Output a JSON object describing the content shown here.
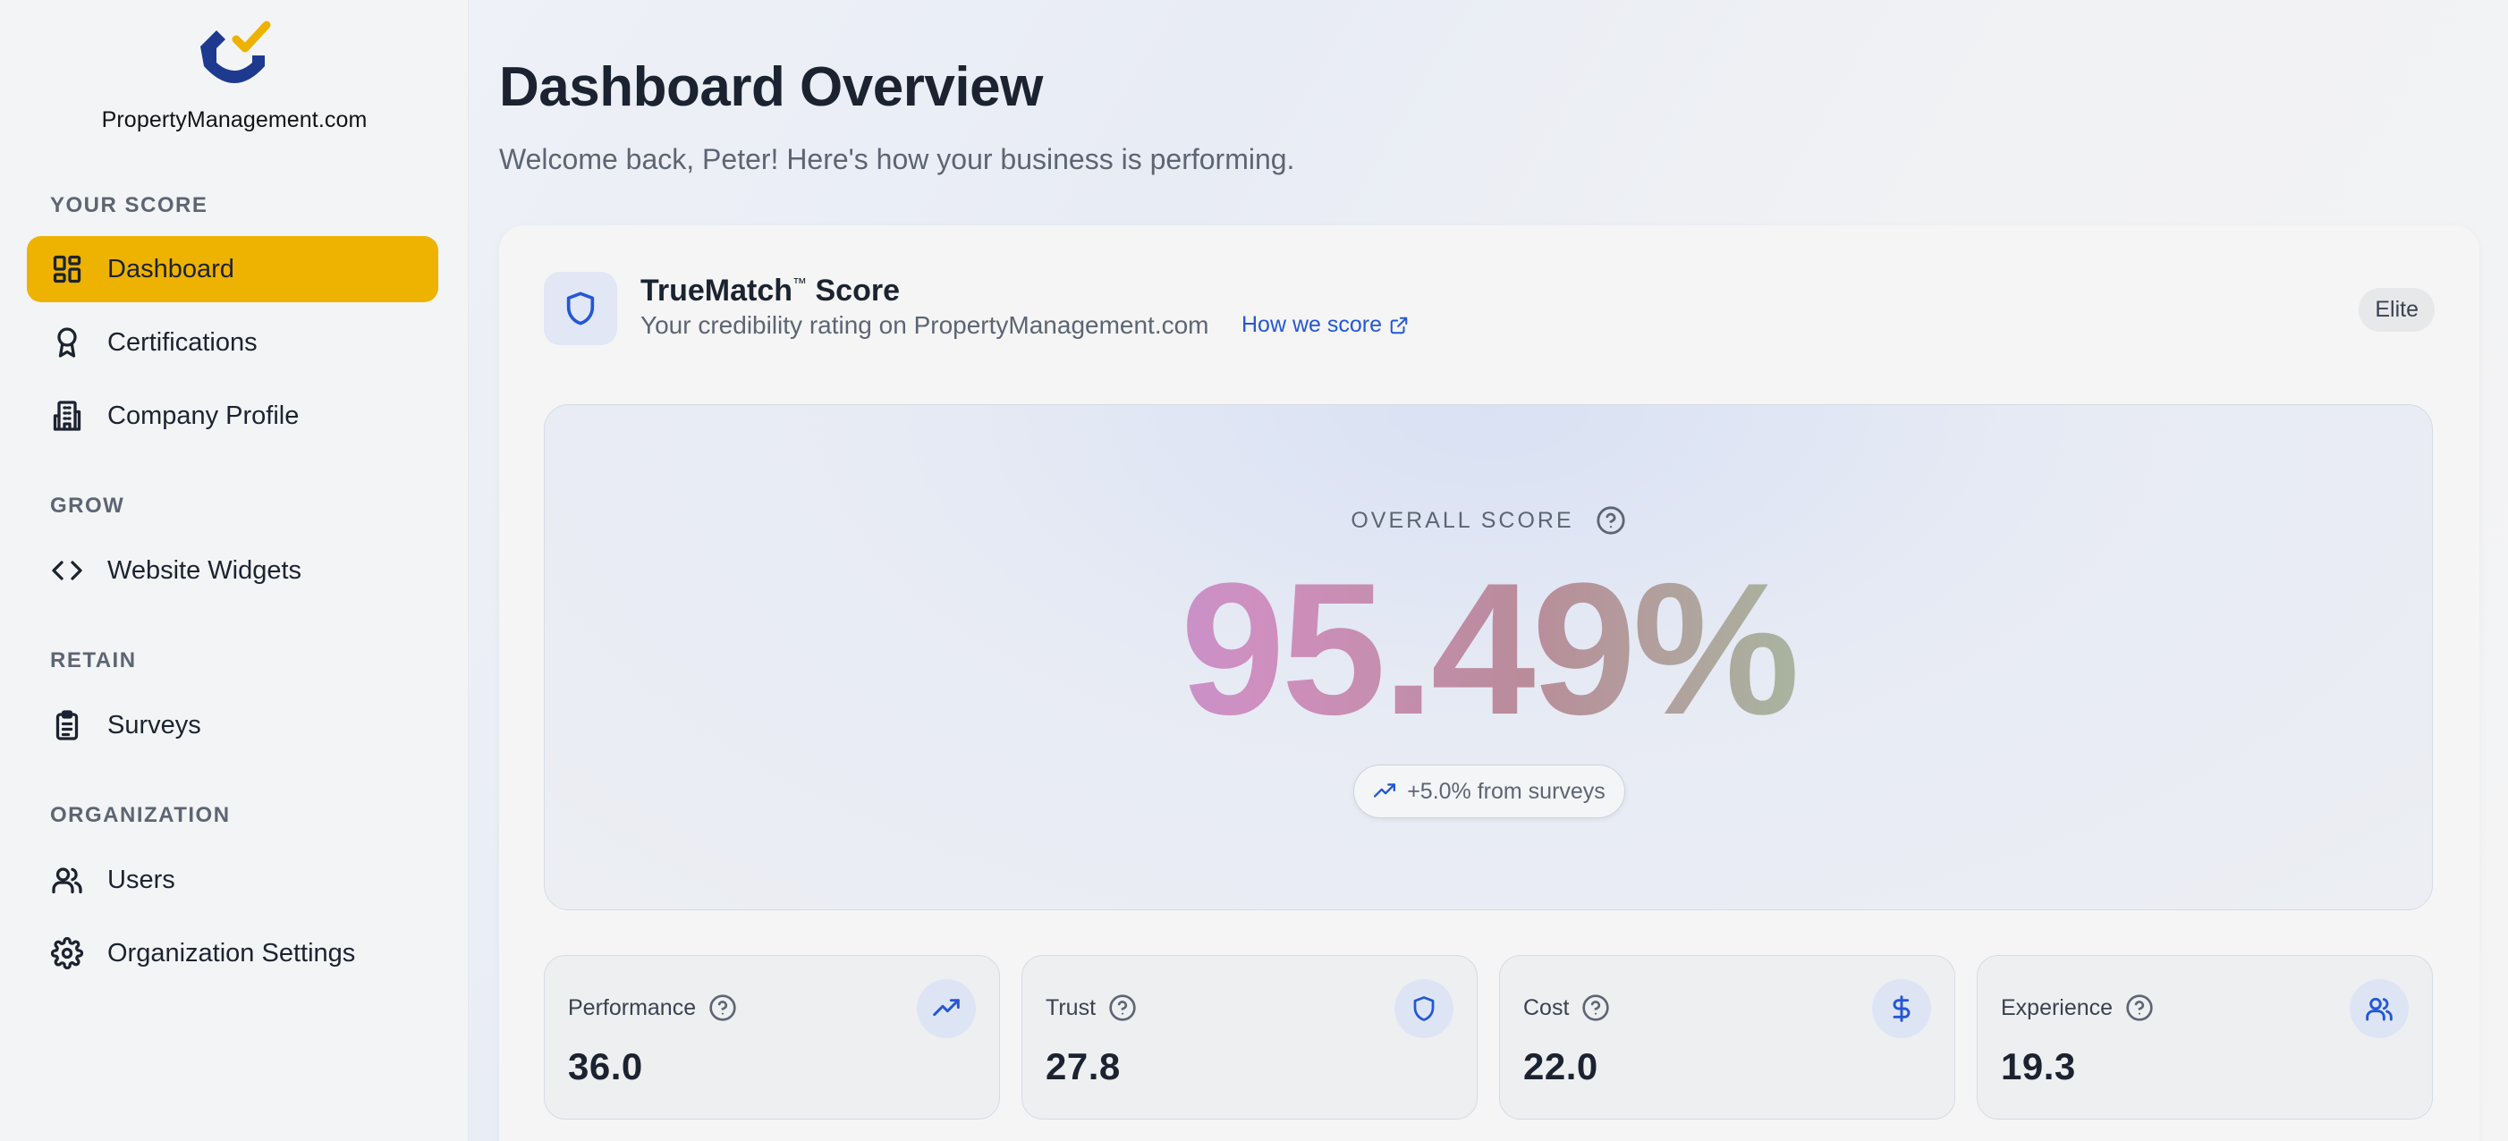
{
  "brand": {
    "name": "PropertyManagement.com"
  },
  "sidebar": {
    "sections": [
      {
        "label": "YOUR SCORE"
      },
      {
        "label": "GROW"
      },
      {
        "label": "RETAIN"
      },
      {
        "label": "ORGANIZATION"
      }
    ],
    "items": [
      {
        "label": "Dashboard",
        "icon": "grid-icon",
        "active": true
      },
      {
        "label": "Certifications",
        "icon": "award-icon"
      },
      {
        "label": "Company Profile",
        "icon": "building-icon"
      },
      {
        "label": "Website Widgets",
        "icon": "code-icon"
      },
      {
        "label": "Surveys",
        "icon": "clipboard-icon"
      },
      {
        "label": "Users",
        "icon": "users-icon"
      },
      {
        "label": "Organization Settings",
        "icon": "gear-icon"
      }
    ],
    "active_color": "#eeb200"
  },
  "header": {
    "title": "Dashboard Overview",
    "subtitle": "Welcome back, Peter! Here's how your business is performing."
  },
  "score_card": {
    "title": "TrueMatch",
    "title_mark": "™",
    "title_suffix": " Score",
    "subtitle": "Your credibility rating on PropertyManagement.com",
    "link_label": "How we score",
    "badge": "Elite",
    "overall_label": "OVERALL SCORE",
    "overall_value": "95.49%",
    "change_label": "+5.0% from surveys"
  },
  "metrics": [
    {
      "name": "Performance",
      "value": "36.0",
      "icon": "trending-up-icon"
    },
    {
      "name": "Trust",
      "value": "27.8",
      "icon": "shield-icon"
    },
    {
      "name": "Cost",
      "value": "22.0",
      "icon": "dollar-icon"
    },
    {
      "name": "Experience",
      "value": "19.3",
      "icon": "users-icon"
    }
  ],
  "colors": {
    "accent": "#2457d6",
    "brand_yellow": "#eeb200",
    "brand_navy": "#1d3a8f"
  }
}
